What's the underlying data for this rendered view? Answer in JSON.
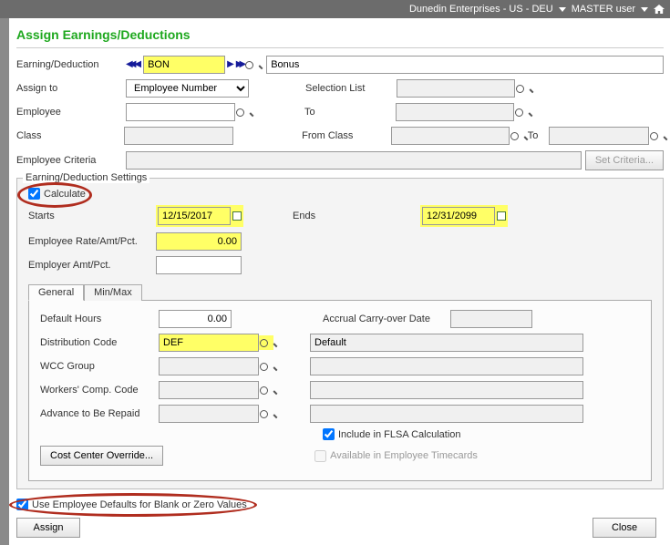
{
  "title_bar": {
    "company": "Dunedin Enterprises - US - DEU",
    "user": "MASTER user"
  },
  "page_title": "Assign Earnings/Deductions",
  "fields": {
    "earning_deduction_label": "Earning/Deduction",
    "earning_deduction_code": "BON",
    "earning_deduction_desc": "Bonus",
    "assign_to_label": "Assign to",
    "assign_to_value": "Employee Number",
    "employee_label": "Employee",
    "employee_value": "",
    "class_label": "Class",
    "class_value": "",
    "criteria_label": "Employee Criteria",
    "criteria_value": "",
    "selection_list_label": "Selection List",
    "selection_list_value": "",
    "to_label": "To",
    "to_value": "",
    "from_class_label": "From Class",
    "from_class_value": "",
    "to_class_label": "To",
    "to_class_value": "",
    "set_criteria_btn": "Set Criteria..."
  },
  "settings": {
    "group_title": "Earning/Deduction Settings",
    "calculate_label": "Calculate",
    "calculate_checked": true,
    "starts_label": "Starts",
    "starts_value": "12/15/2017",
    "ends_label": "Ends",
    "ends_value": "12/31/2099",
    "emp_rate_label": "Employee Rate/Amt/Pct.",
    "emp_rate_value": "0.00",
    "empr_amt_label": "Employer Amt/Pct.",
    "empr_amt_value": ""
  },
  "tabs": {
    "general": "General",
    "minmax": "Min/Max"
  },
  "general": {
    "default_hours_label": "Default Hours",
    "default_hours_value": "0.00",
    "dist_code_label": "Distribution Code",
    "dist_code_value": "DEF",
    "dist_code_desc": "Default",
    "wcc_group_label": "WCC Group",
    "wcc_group_value": "",
    "wcc_group_desc": "",
    "wc_code_label": "Workers' Comp. Code",
    "wc_code_value": "",
    "wc_code_desc": "",
    "advance_label": "Advance to Be Repaid",
    "advance_value": "",
    "advance_desc": "",
    "accrual_label": "Accrual Carry-over Date",
    "accrual_value": "",
    "flsa_label": "Include in FLSA Calculation",
    "flsa_checked": true,
    "avail_tc_label": "Available in Employee Timecards",
    "avail_tc_checked": false,
    "cost_center_btn": "Cost Center Override..."
  },
  "bottom": {
    "use_defaults_label": "Use Employee Defaults for Blank or Zero Values",
    "use_defaults_checked": true,
    "assign_btn": "Assign",
    "close_btn": "Close"
  }
}
